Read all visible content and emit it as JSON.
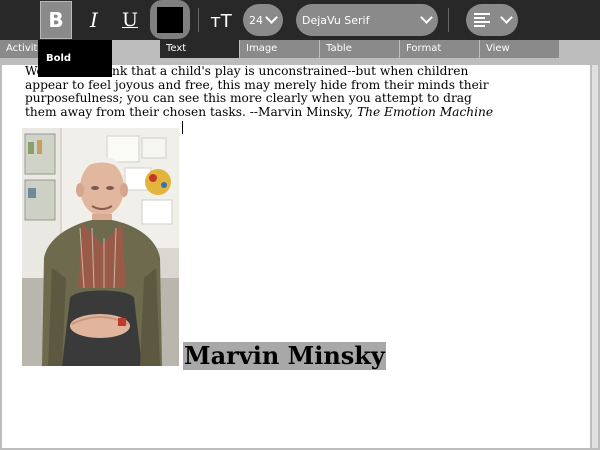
{
  "toolbar": {
    "bold_label": "B",
    "italic_label": "I",
    "underline_label": "U",
    "font_size_icon": "тT",
    "font_size_value": "24",
    "font_family_value": "DejaVu Serif",
    "text_color": "#000000"
  },
  "tooltip": {
    "label": "Bold"
  },
  "tabs": [
    {
      "label": "Activity"
    },
    {
      "label": "Text"
    },
    {
      "label": "Image"
    },
    {
      "label": "Table"
    },
    {
      "label": "Format"
    },
    {
      "label": "View"
    }
  ],
  "document": {
    "quote_line1": "We tend to think that a child's play is unconstrained--but when children",
    "quote_line2": "appear to feel joyous and free, this may merely hide from their minds their",
    "quote_line3": "purposefulness; you can see this more clearly when you attempt to drag",
    "quote_line4_prefix": "them away from their chosen tasks. --Marvin Minsky, ",
    "quote_book": "The Emotion Machine",
    "heading": "Marvin Minsky"
  },
  "colors": {
    "toolbar_bg": "#282828",
    "button_bg": "#8a8a8a",
    "tab_strip": "#bdbdbd",
    "heading_highlight": "#a8a8a8"
  }
}
